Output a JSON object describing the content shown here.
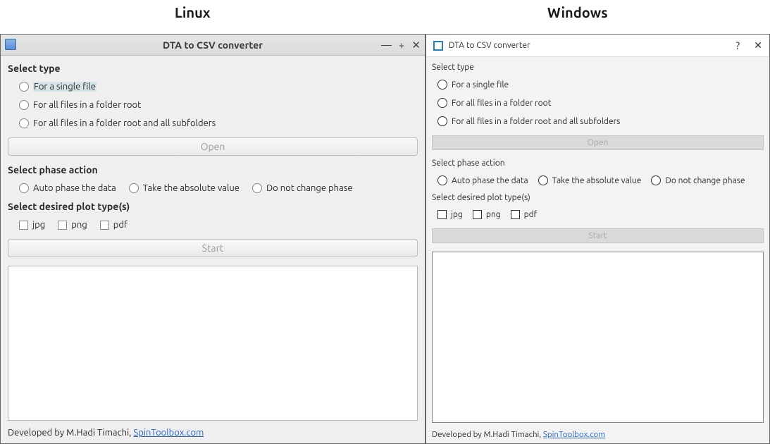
{
  "top_labels": {
    "linux": "Linux",
    "windows": "Windows"
  },
  "title": "DTA to CSV converter",
  "sections": {
    "select_type": "Select type",
    "select_phase": "Select phase action",
    "select_plots": "Select desired plot type(s)"
  },
  "type_options": {
    "single": "For a single file",
    "folder": "For all files in a folder root",
    "folder_sub": "For all files in a folder root and all subfolders"
  },
  "phase_options": {
    "auto": "Auto phase the data",
    "abs": "Take the absolute value",
    "nochange": "Do not change phase"
  },
  "plot_options": {
    "jpg": "jpg",
    "png": "png",
    "pdf": "pdf"
  },
  "buttons": {
    "open": "Open",
    "start": "Start"
  },
  "footer": {
    "prefix": "Developed by M.Hadi Timachi, ",
    "link_text": "SpinToolbox.com"
  },
  "win_controls": {
    "help": "?",
    "close": "✕",
    "min": "—",
    "max": "+"
  }
}
